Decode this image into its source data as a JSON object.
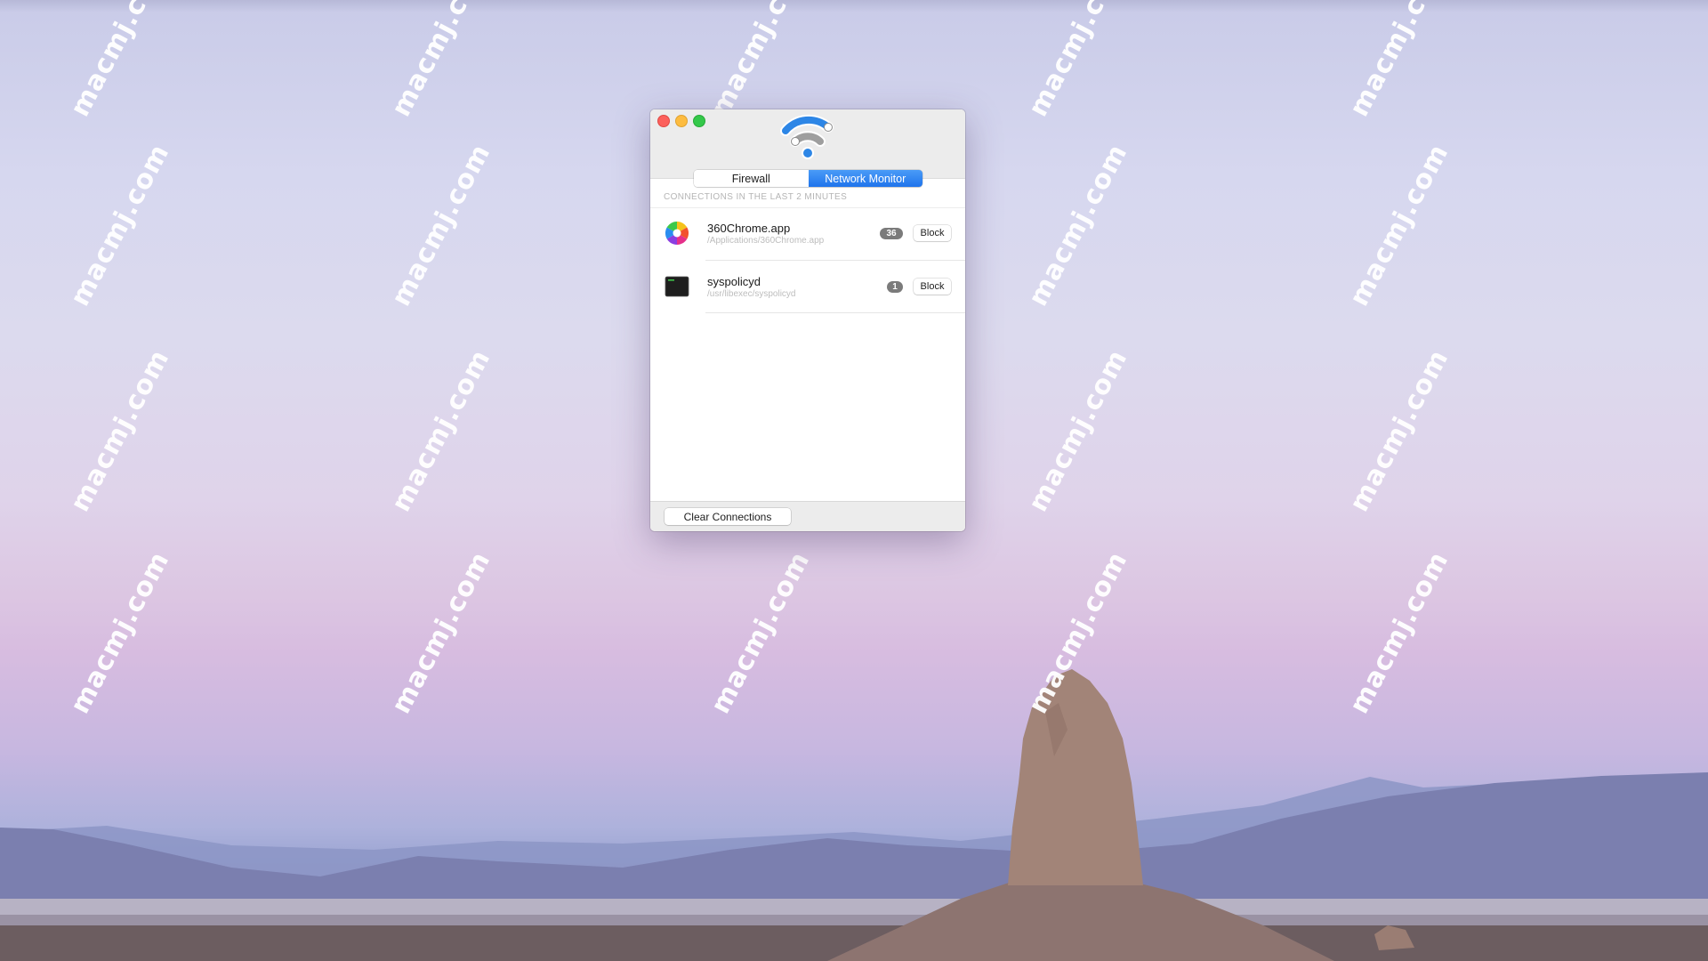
{
  "window": {
    "controls": [
      "close",
      "minimize",
      "maximize"
    ],
    "app_icon": "wifi-icon",
    "tabs": [
      {
        "label": "Firewall",
        "active": false
      },
      {
        "label": "Network Monitor",
        "active": true
      }
    ],
    "caption": "CONNECTIONS IN THE LAST 2 MINUTES",
    "connections": [
      {
        "name": "360Chrome.app",
        "path": "/Applications/360Chrome.app",
        "count": "36",
        "icon": "360chrome-app-icon",
        "action": "Block"
      },
      {
        "name": "syspolicyd",
        "path": "/usr/libexec/syspolicyd",
        "count": "1",
        "icon": "terminal-exec-icon",
        "action": "Block"
      }
    ],
    "footer_button": "Clear Connections"
  },
  "colors": {
    "accent": "#1f74ec",
    "close": "#fc605c",
    "minimize": "#fdbc40",
    "maximize": "#34c84a",
    "badge": "#7b7b7b"
  },
  "desktop": {
    "watermark_text": "macmj.com"
  }
}
